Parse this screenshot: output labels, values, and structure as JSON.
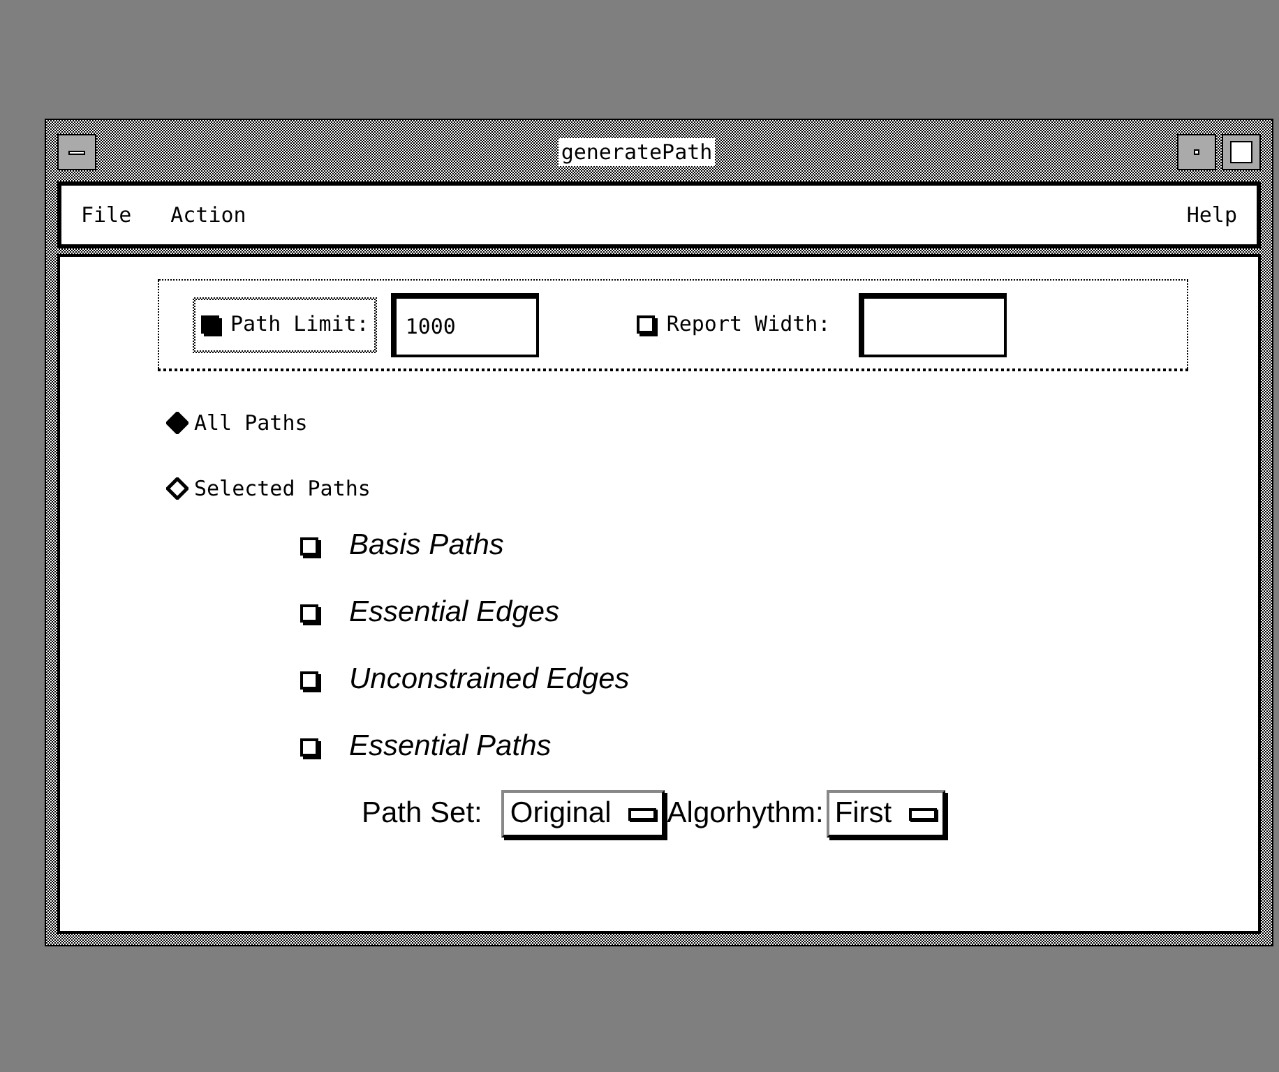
{
  "window": {
    "title": "generatePath"
  },
  "menu": [
    {
      "label": "File"
    },
    {
      "label": "Action"
    },
    {
      "label": "Help"
    }
  ],
  "limits": {
    "path_limit": {
      "label": "Path Limit:",
      "checked": true,
      "value": "1000"
    },
    "report_width": {
      "label": "Report Width:",
      "checked": false
    }
  },
  "path_mode": [
    {
      "label": "All Paths",
      "selected": true
    },
    {
      "label": "Selected Paths",
      "selected": false
    }
  ],
  "path_types": [
    {
      "label": "Basis Paths",
      "checked": false
    },
    {
      "label": "Essential Edges",
      "checked": false
    },
    {
      "label": "Unconstrained Edges",
      "checked": false
    },
    {
      "label": "Essential Paths",
      "checked": false
    }
  ],
  "path_set": {
    "label": "Path Set:",
    "value": "Original"
  },
  "algorithm": {
    "label": "Algorhythm:",
    "value": "First"
  }
}
